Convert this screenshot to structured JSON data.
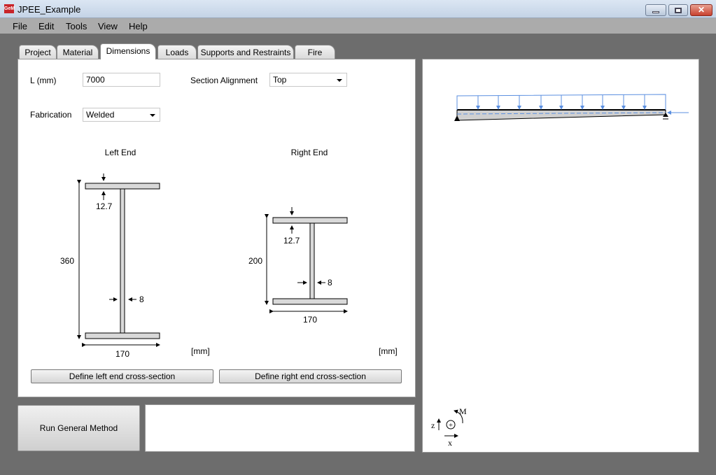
{
  "window": {
    "title": "JPEE_Example",
    "icon": "GeM",
    "controls": [
      "minimize",
      "maximize",
      "close"
    ]
  },
  "menu": [
    "File",
    "Edit",
    "Tools",
    "View",
    "Help"
  ],
  "tabs": [
    {
      "label": "Project"
    },
    {
      "label": "Material"
    },
    {
      "label": "Dimensions",
      "active": true
    },
    {
      "label": "Loads"
    },
    {
      "label": "Supports and Restraints"
    },
    {
      "label": "Fire"
    }
  ],
  "form": {
    "length_label": "L (mm)",
    "length_value": "7000",
    "alignment_label": "Section Alignment",
    "alignment_value": "Top",
    "fabrication_label": "Fabrication",
    "fabrication_value": "Welded"
  },
  "left_end": {
    "title": "Left End",
    "height": "360",
    "flange_thickness": "12.7",
    "web_thickness": "8",
    "width": "170",
    "unit": "[mm]",
    "button": "Define left end cross-section"
  },
  "right_end": {
    "title": "Right End",
    "height": "200",
    "flange_thickness": "12.7",
    "web_thickness": "8",
    "width": "170",
    "unit": "[mm]",
    "button": "Define right end cross-section"
  },
  "run_button": "Run General Method",
  "axes": {
    "z": "z",
    "x": "x",
    "m": "M"
  },
  "colors": {
    "load": "#5b8fe0",
    "beam": "#d0d0d0"
  }
}
